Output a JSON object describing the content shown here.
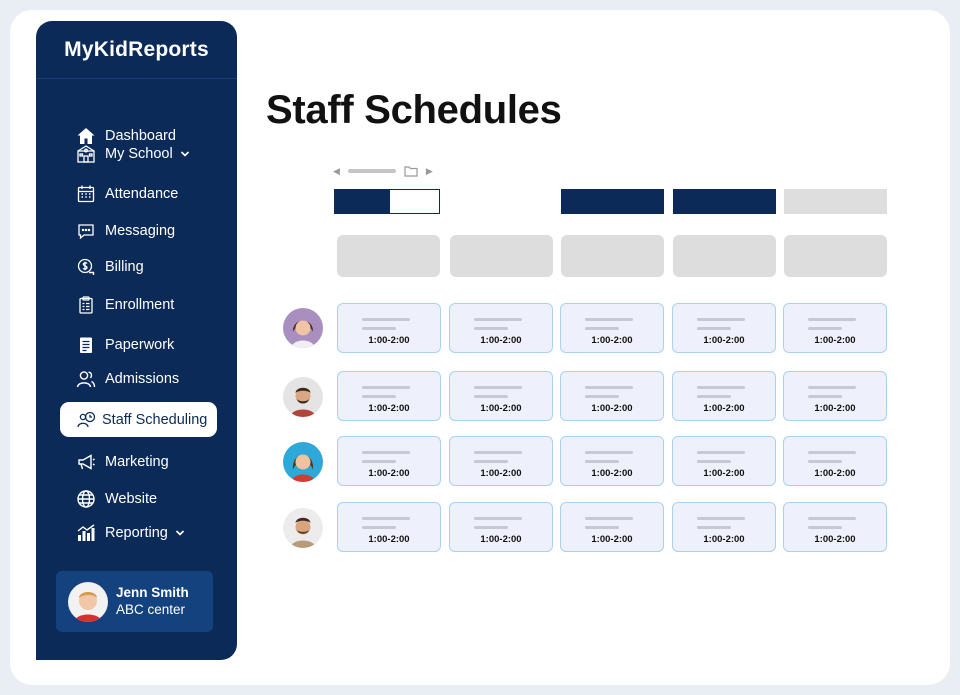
{
  "app": {
    "brand": "MyKidReports"
  },
  "sidebar": {
    "items": [
      {
        "label": "Dashboard",
        "icon": "home-icon"
      },
      {
        "label": "My School",
        "icon": "school-icon",
        "has_dropdown": true
      },
      {
        "label": "Attendance",
        "icon": "calendar-icon"
      },
      {
        "label": "Messaging",
        "icon": "chat-icon"
      },
      {
        "label": "Billing",
        "icon": "billing-icon"
      },
      {
        "label": "Enrollment",
        "icon": "clipboard-icon"
      },
      {
        "label": "Paperwork",
        "icon": "document-icon"
      },
      {
        "label": "Admissions",
        "icon": "users-icon"
      },
      {
        "label": "Staff Scheduling",
        "icon": "staff-schedule-icon",
        "active": true
      },
      {
        "label": "Marketing",
        "icon": "megaphone-icon"
      },
      {
        "label": "Website",
        "icon": "globe-icon"
      },
      {
        "label": "Reporting",
        "icon": "bar-chart-icon",
        "has_dropdown": true
      }
    ],
    "profile": {
      "name": "Jenn Smith",
      "org": "ABC center"
    }
  },
  "main": {
    "title": "Staff Schedules",
    "schedule": {
      "rows": [
        {
          "staff": "staff-1",
          "slots": [
            "1:00-2:00",
            "1:00-2:00",
            "1:00-2:00",
            "1:00-2:00",
            "1:00-2:00"
          ]
        },
        {
          "staff": "staff-2",
          "slots": [
            "1:00-2:00",
            "1:00-2:00",
            "1:00-2:00",
            "1:00-2:00",
            "1:00-2:00"
          ]
        },
        {
          "staff": "staff-3",
          "slots": [
            "1:00-2:00",
            "1:00-2:00",
            "1:00-2:00",
            "1:00-2:00",
            "1:00-2:00"
          ]
        },
        {
          "staff": "staff-4",
          "slots": [
            "1:00-2:00",
            "1:00-2:00",
            "1:00-2:00",
            "1:00-2:00",
            "1:00-2:00"
          ]
        }
      ]
    }
  },
  "colors": {
    "sidebar_bg": "#0b2a57",
    "profile_bg": "#14427f",
    "accent_dark": "#0b2a57",
    "placeholder_gray": "#dddddd",
    "cell_bg": "#eef0fb",
    "cell_border": "#a9d2ee"
  }
}
